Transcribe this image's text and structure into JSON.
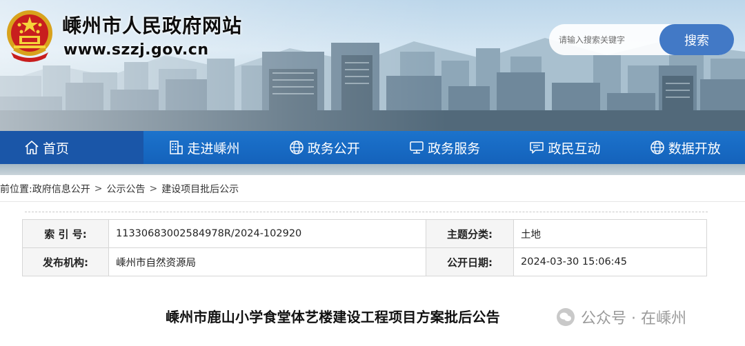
{
  "header": {
    "site_title": "嵊州市人民政府网站",
    "site_url": "www.szzj.gov.cn",
    "emblem_icon": "national-emblem",
    "search": {
      "placeholder": "请输入搜索关键字",
      "button_label": "搜索"
    },
    "accent_color": "#1466c2"
  },
  "nav": {
    "items": [
      {
        "label": "首页",
        "icon": "home-icon",
        "active": true
      },
      {
        "label": "走进嵊州",
        "icon": "building-icon",
        "active": false
      },
      {
        "label": "政务公开",
        "icon": "globe-icon",
        "active": false
      },
      {
        "label": "政务服务",
        "icon": "monitor-icon",
        "active": false
      },
      {
        "label": "政民互动",
        "icon": "chat-icon",
        "active": false
      },
      {
        "label": "数据开放",
        "icon": "globe-icon",
        "active": false
      }
    ]
  },
  "breadcrumb": {
    "prefix": "当前位置:",
    "items": [
      "政府信息公开",
      "公示公告",
      "建设项目批后公示"
    ],
    "separator": ">"
  },
  "info": {
    "index_label": "索 引 号:",
    "index_value": "11330683002584978R/2024-102920",
    "topic_label": "主题分类:",
    "topic_value": "土地",
    "publisher_label": "发布机构:",
    "publisher_value": "嵊州市自然资源局",
    "date_label": "公开日期:",
    "date_value": "2024-03-30 15:06:45"
  },
  "article": {
    "title": "嵊州市鹿山小学食堂体艺楼建设工程项目方案批后公告"
  },
  "watermark": {
    "text": "公众号 · 在嵊州"
  }
}
